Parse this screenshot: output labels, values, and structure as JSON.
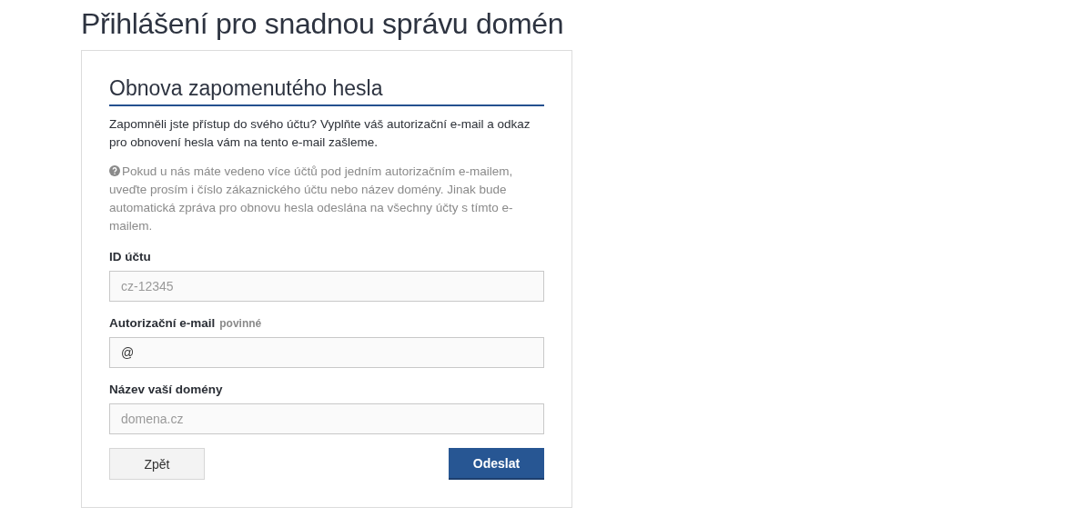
{
  "page_title": "Přihlášení pro snadnou správu domén",
  "form": {
    "title": "Obnova zapomenutého hesla",
    "intro": "Zapomněli jste přístup do svého účtu? Vyplňte váš autorizační e-mail a odkaz pro obnovení hesla vám na tento e-mail zašleme.",
    "help": "Pokud u nás máte vedeno více účtů pod jedním autorizačním e-mailem, uveďte prosím i číslo zákaznického účtu nebo název domény. Jinak bude automatická zpráva pro obnovu hesla odeslána na všechny účty s tímto e-mailem.",
    "fields": [
      {
        "label": "ID účtu",
        "placeholder": "cz-12345"
      },
      {
        "label": "Autorizační e-mail",
        "hint": "povinné",
        "value": "@"
      },
      {
        "label": "Název vaší domény",
        "placeholder": "domena.cz"
      }
    ],
    "buttons": [
      {
        "label": "Zpět",
        "kind": "secondary"
      },
      {
        "label": "Odeslat",
        "kind": "primary"
      }
    ]
  }
}
